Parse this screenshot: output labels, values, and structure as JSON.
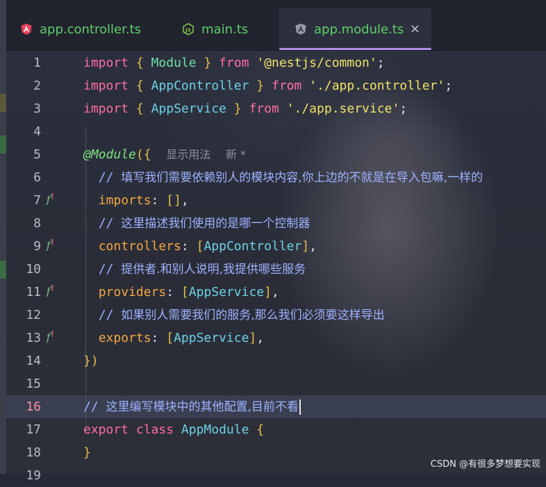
{
  "tabs": [
    {
      "label": "app.controller.ts",
      "icon": "angular-icon"
    },
    {
      "label": "main.ts",
      "icon": "nodejs-icon"
    },
    {
      "label": "app.module.ts",
      "icon": "angular-icon",
      "active": true,
      "close": "×"
    }
  ],
  "editor": {
    "current_line": 16,
    "line_numbers": [
      "1",
      "2",
      "3",
      "4",
      "5",
      "6",
      "7",
      "8",
      "9",
      "10",
      "11",
      "12",
      "13",
      "14",
      "15",
      "16",
      "17",
      "18",
      "19"
    ],
    "gutter_icon_label": "f",
    "lines": {
      "l1": {
        "import": "import",
        "open": "{",
        "name": "Module",
        "close": "}",
        "from": "from",
        "path": "'@nestjs/common'",
        "semi": ";"
      },
      "l2": {
        "import": "import",
        "open": "{",
        "name": "AppController",
        "close": "}",
        "from": "from",
        "path": "'./app.controller'",
        "semi": ";"
      },
      "l3": {
        "import": "import",
        "open": "{",
        "name": "AppService",
        "close": "}",
        "from": "from",
        "path": "'./app.service'",
        "semi": ";"
      },
      "l5": {
        "decorator": "@Module",
        "open": "({",
        "hint1": "显示用法",
        "hint2": "新 *"
      },
      "l6": {
        "slashes": "//",
        "text": "填写我们需要依赖别人的模块内容,你上边的不就是在导入包嘛,一样的"
      },
      "l7": {
        "prop": "imports",
        "colon": ":",
        "value": "[]",
        "comma": ","
      },
      "l8": {
        "slashes": "//",
        "text": "这里描述我们使用的是哪一个控制器"
      },
      "l9": {
        "prop": "controllers",
        "colon": ":",
        "lb": "[",
        "value": "AppController",
        "rb": "]",
        "comma": ","
      },
      "l10": {
        "slashes": "//",
        "text": "提供者.和别人说明,我提供哪些服务"
      },
      "l11": {
        "prop": "providers",
        "colon": ":",
        "lb": "[",
        "value": "AppService",
        "rb": "]",
        "comma": ","
      },
      "l12": {
        "slashes": "//",
        "text": "如果别人需要我们的服务,那么我们必须要这样导出"
      },
      "l13": {
        "prop": "exports",
        "colon": ":",
        "lb": "[",
        "value": "AppService",
        "rb": "]",
        "comma": ","
      },
      "l14": {
        "close": "})"
      },
      "l16": {
        "slashes": "//",
        "text": "这里编写模块中的其他配置,目前不看"
      },
      "l17": {
        "export": "export",
        "class": "class",
        "name": "AppModule",
        "open": "{"
      },
      "l18": {
        "close": "}"
      }
    }
  },
  "watermark": "CSDN @有很多梦想要实现",
  "colors": {
    "keyword": "#ff6ea4",
    "string": "#f2e46a",
    "comment": "#9fb2ff",
    "property": "#f5a742",
    "tab_underline": "#b08ee6",
    "current_line_number": "#ff8fa8"
  }
}
